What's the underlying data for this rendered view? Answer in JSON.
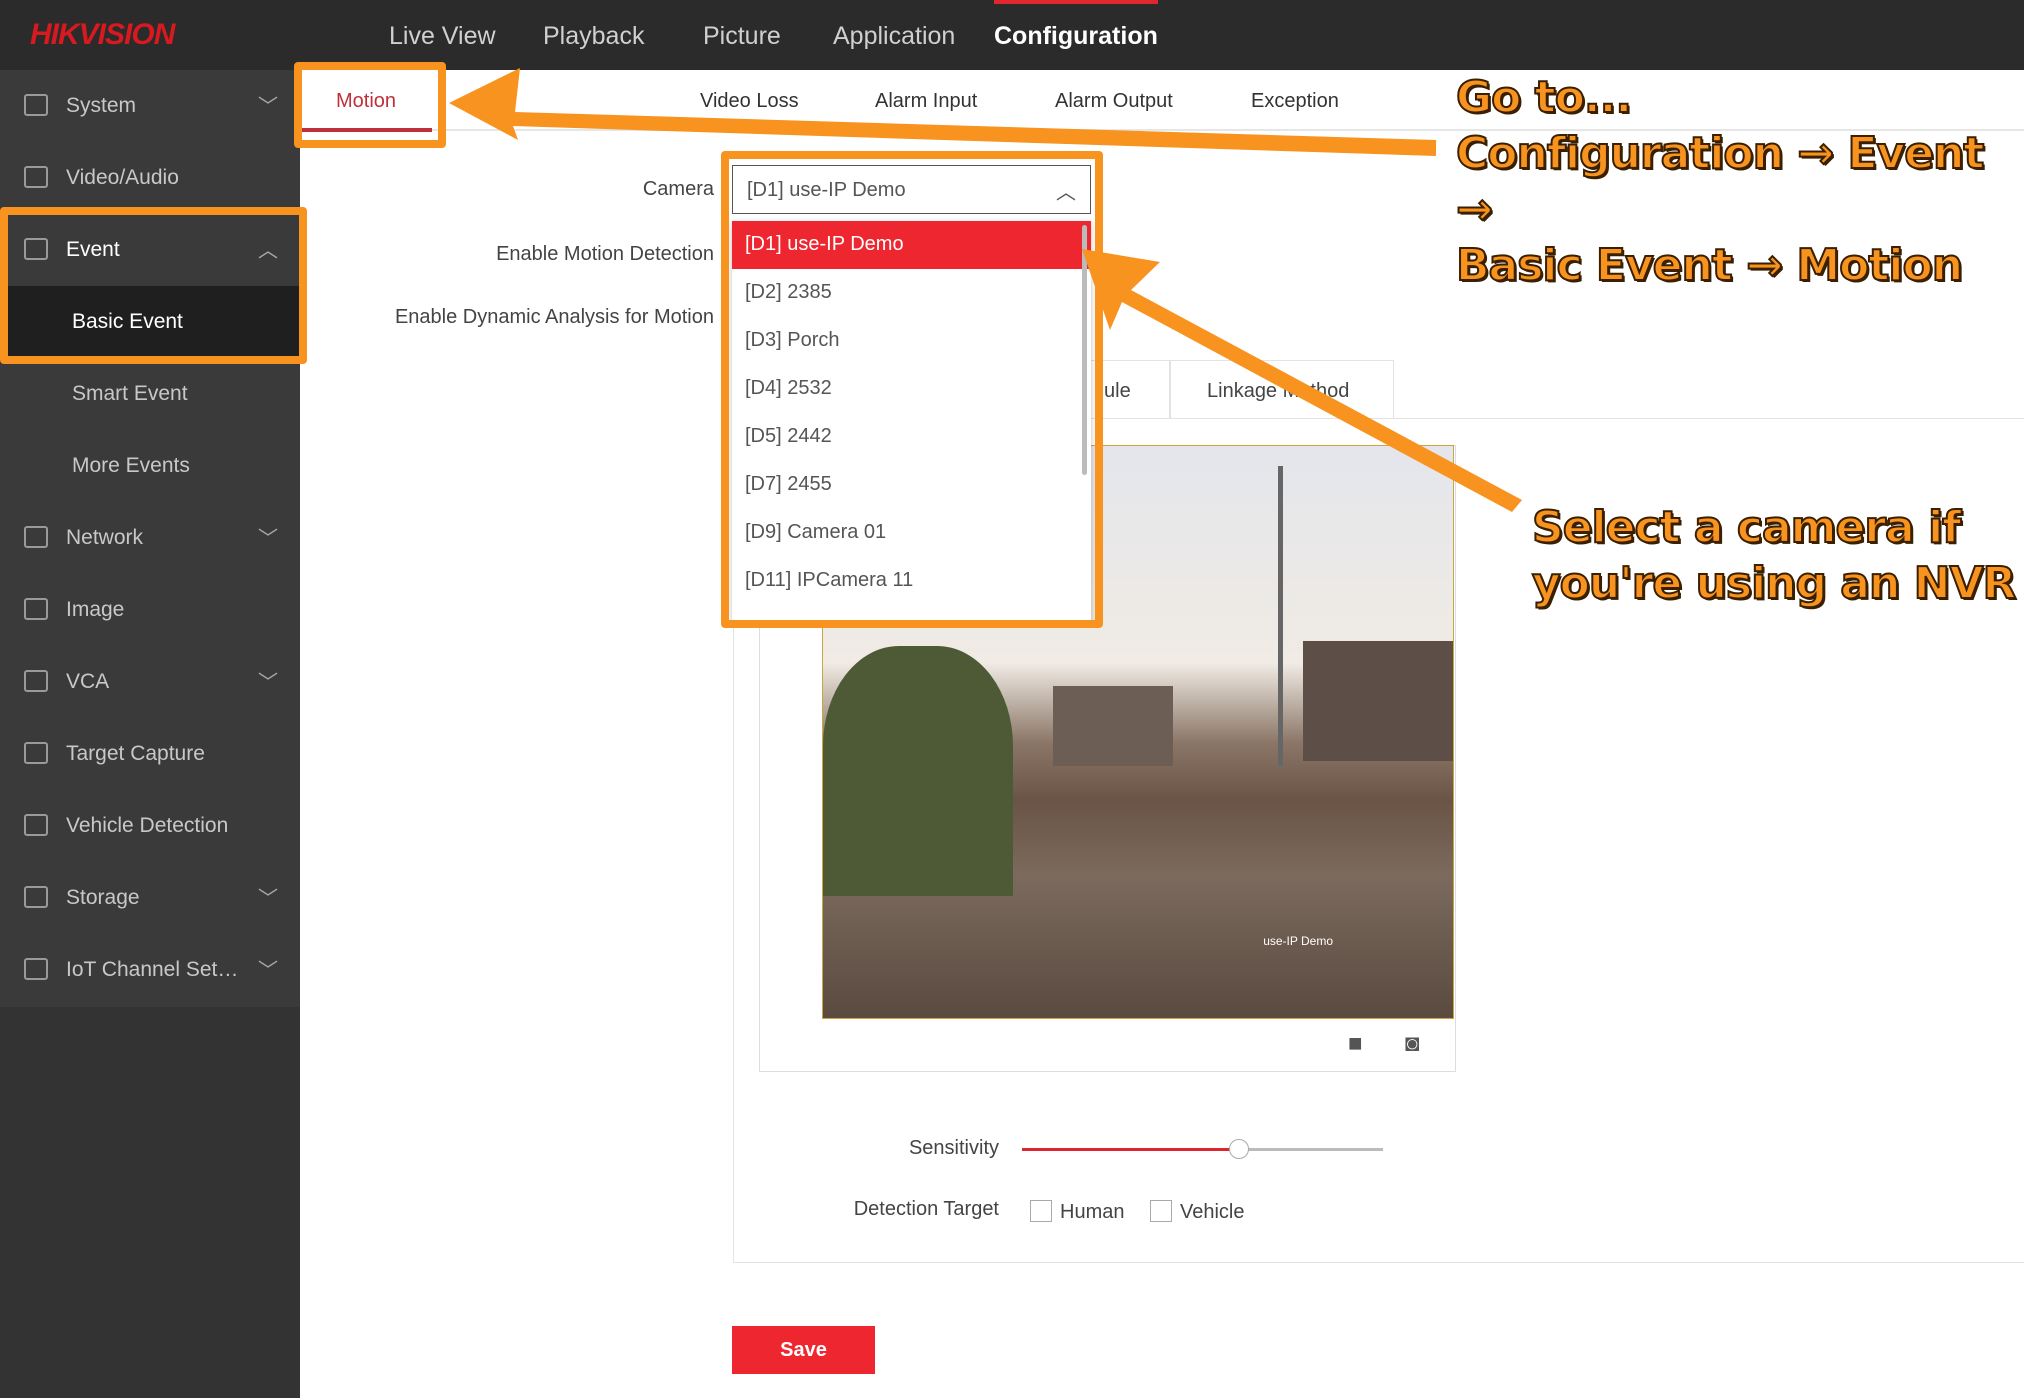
{
  "header": {
    "logo": "HIKVISION",
    "nav": [
      "Live View",
      "Playback",
      "Picture",
      "Application",
      "Configuration"
    ],
    "active_nav": "Configuration"
  },
  "sidebar": {
    "items": [
      {
        "label": "System",
        "icon": "monitor-icon",
        "chevron": "down"
      },
      {
        "label": "Video/Audio",
        "icon": "camera-icon",
        "chevron": ""
      },
      {
        "label": "Event",
        "icon": "clipboard-icon",
        "chevron": "up"
      },
      {
        "label": "Basic Event",
        "sub": true
      },
      {
        "label": "Smart Event",
        "sub": true
      },
      {
        "label": "More Events",
        "sub": true
      },
      {
        "label": "Network",
        "icon": "globe-icon",
        "chevron": "down"
      },
      {
        "label": "Image",
        "icon": "image-icon",
        "chevron": ""
      },
      {
        "label": "VCA",
        "icon": "bulb-icon",
        "chevron": "down"
      },
      {
        "label": "Target Capture",
        "icon": "person-icon",
        "chevron": ""
      },
      {
        "label": "Vehicle Detection",
        "icon": "car-icon",
        "chevron": ""
      },
      {
        "label": "Storage",
        "icon": "floppy-icon",
        "chevron": "down"
      },
      {
        "label": "IoT Channel Set…",
        "icon": "iot-icon",
        "chevron": "down"
      }
    ]
  },
  "tabs": [
    "Motion",
    "Video Loss",
    "Alarm Input",
    "Alarm Output",
    "Exception"
  ],
  "form": {
    "camera_label": "Camera",
    "camera_value": "[D1] use-IP Demo",
    "camera_options": [
      "[D1] use-IP Demo",
      "[D2] 2385",
      "[D3] Porch",
      "[D4] 2532",
      "[D5] 2442",
      "[D7] 2455",
      "[D9] Camera 01",
      "[D11] IPCamera 11"
    ],
    "enable_motion_label": "Enable Motion Detection",
    "enable_dynamic_label": "Enable Dynamic Analysis for Motion",
    "subtabs": [
      "ule",
      "Linkage Method"
    ],
    "video_overlay": "use-IP Demo",
    "sensitivity_label": "Sensitivity",
    "sensitivity_percent": 60,
    "detection_target_label": "Detection Target",
    "targets": [
      "Human",
      "Vehicle"
    ],
    "save": "Save"
  },
  "annotations": {
    "goto": [
      "Go to...",
      "Configuration → Event →",
      "Basic Event → Motion"
    ],
    "select": [
      "Select a camera if",
      "you're using an NVR"
    ],
    "color": "#f7931e"
  },
  "colors": {
    "accent": "#ee2630",
    "topbar": "#2b2b2b",
    "sidebar": "#3a3a3a"
  }
}
